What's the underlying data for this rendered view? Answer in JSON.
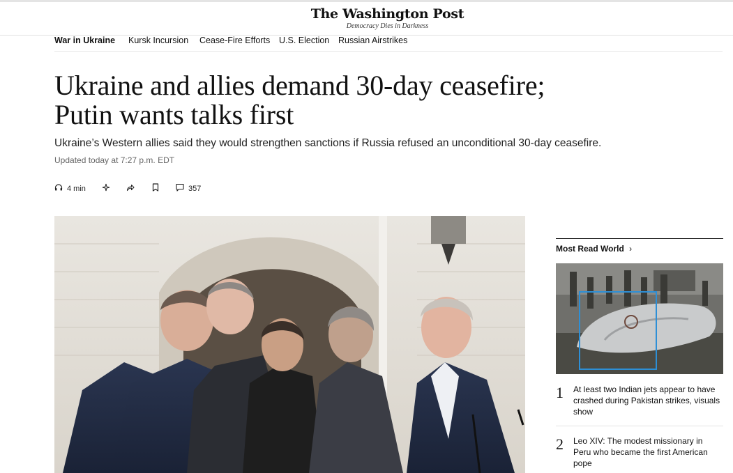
{
  "masthead": {
    "logo": "The Washington Post",
    "tagline": "Democracy Dies in Darkness"
  },
  "nav": {
    "items": [
      {
        "label": "War in Ukraine"
      },
      {
        "label": "Kursk Incursion"
      },
      {
        "label": "Cease-Fire Efforts"
      },
      {
        "label": "U.S. Election"
      },
      {
        "label": "Russian Airstrikes"
      }
    ]
  },
  "article": {
    "headline_line1": "Ukraine and allies demand 30-day ceasefire;",
    "headline_line2": "Putin wants talks first",
    "subhead": "Ukraine’s Western allies said they would strengthen sanctions if Russia refused an unconditional 30-day ceasefire.",
    "updated": "Updated today at 7:27 p.m. EDT"
  },
  "actions": {
    "listen_label": "4 min",
    "comments_count": "357",
    "icons": [
      "headphones-icon",
      "sparkle-icon",
      "share-icon",
      "bookmark-icon",
      "comment-icon"
    ]
  },
  "sidebar": {
    "title": "Most Read World",
    "title_arrow": "›",
    "items": [
      {
        "number": "1",
        "text": "At least two Indian jets appear to have crashed during Pakistan strikes, visuals show"
      },
      {
        "number": "2",
        "text": "Leo XIV: The modest missionary in Peru who became the first American pope"
      }
    ]
  }
}
